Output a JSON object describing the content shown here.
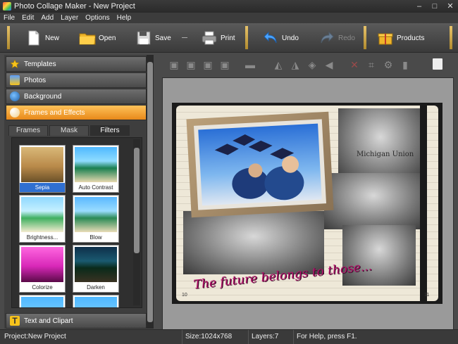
{
  "window": {
    "title": "Photo Collage Maker - New Project",
    "controls": [
      "–",
      "□",
      "✕"
    ]
  },
  "menu": [
    "File",
    "Edit",
    "Add",
    "Layer",
    "Options",
    "Help"
  ],
  "toolbar": {
    "new": "New",
    "open": "Open",
    "save": "Save",
    "print": "Print",
    "undo": "Undo",
    "redo": "Redo",
    "products": "Products"
  },
  "sidebar": {
    "panels": [
      "Templates",
      "Photos",
      "Background",
      "Frames and Effects"
    ],
    "subtabs": [
      "Frames",
      "Mask",
      "Filters"
    ],
    "active_subtab": "Filters",
    "filters": [
      "Sepia",
      "Auto Contrast",
      "Brightness...",
      "Blow",
      "Colorize",
      "Darken"
    ],
    "selected_filter": "Sepia",
    "bottom_panel": "Text and Clipart"
  },
  "collage": {
    "caption": "The future belongs to those...",
    "sign_text": "Michigan Union",
    "page_left": "10",
    "page_right": "11"
  },
  "status": {
    "project": "Project:New Project",
    "size": "Size:1024x768",
    "layers": "Layers:7",
    "help": "For Help, press F1."
  },
  "colors": {
    "accent": "#e8891a",
    "selection": "#2f6fd0",
    "caption": "#b3126a"
  }
}
